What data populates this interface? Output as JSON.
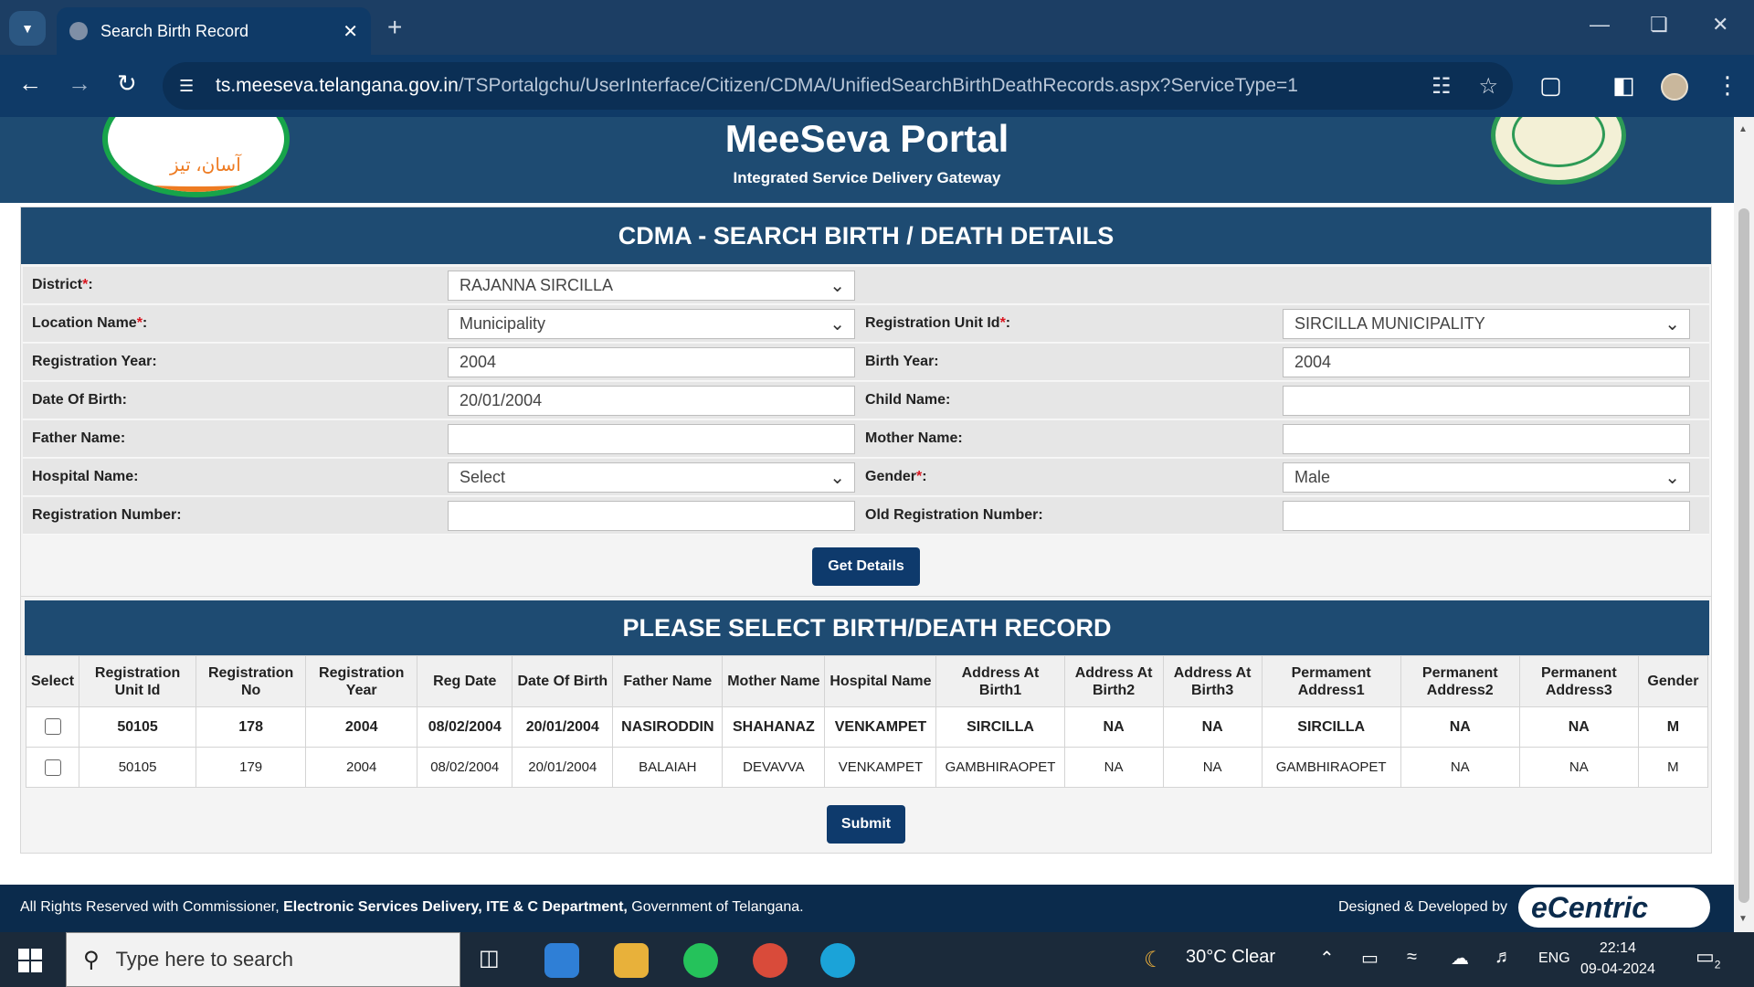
{
  "browser": {
    "tab_title": "Search Birth Record",
    "url_host": "ts.meeseva.telangana.gov.in",
    "url_path": "/TSPortalgchu/UserInterface/Citizen/CDMA/UnifiedSearchBirthDeathRecords.aspx?ServiceType=1",
    "icons": [
      "chevron-down-icon",
      "close-icon",
      "plus-icon",
      "minimize-icon",
      "restore-icon",
      "back-icon",
      "forward-icon",
      "reload-icon",
      "tune-icon",
      "translate-icon",
      "star-icon",
      "extensions-icon",
      "sidepanel-icon",
      "profile-avatar",
      "menu-icon"
    ]
  },
  "header": {
    "left_logo_text": "آسان، تیز",
    "title": "MeeSeva Portal",
    "subtitle": "Integrated Service Delivery Gateway"
  },
  "form": {
    "heading": "CDMA - SEARCH BIRTH / DEATH DETAILS",
    "required_mark": "*",
    "fields": {
      "district": {
        "label": "District",
        "value": "RAJANNA SIRCILLA"
      },
      "location_name": {
        "label": "Location Name",
        "value": "Municipality"
      },
      "registration_unit_id": {
        "label": "Registration Unit Id",
        "value": "SIRCILLA MUNICIPALITY"
      },
      "registration_year": {
        "label": "Registration Year:",
        "value": "2004"
      },
      "birth_year": {
        "label": "Birth Year:",
        "value": "2004"
      },
      "date_of_birth": {
        "label": "Date Of Birth:",
        "value": "20/01/2004"
      },
      "child_name": {
        "label": "Child Name:",
        "value": ""
      },
      "father_name": {
        "label": "Father Name:",
        "value": ""
      },
      "mother_name": {
        "label": "Mother Name:",
        "value": ""
      },
      "hospital_name": {
        "label": "Hospital Name:",
        "value": "Select"
      },
      "gender": {
        "label": "Gender",
        "value": "Male"
      },
      "registration_number": {
        "label": "Registration Number:",
        "value": ""
      },
      "old_registration_number": {
        "label": "Old Registration Number:",
        "value": ""
      }
    },
    "get_details_label": "Get Details"
  },
  "records": {
    "heading": "PLEASE SELECT BIRTH/DEATH RECORD",
    "columns": [
      "Select",
      "Registration Unit Id",
      "Registration No",
      "Registration Year",
      "Reg Date",
      "Date Of Birth",
      "Father Name",
      "Mother Name",
      "Hospital Name",
      "Address At Birth1",
      "Address At Birth2",
      "Address At Birth3",
      "Permament Address1",
      "Permanent Address2",
      "Permanent Address3",
      "Gender"
    ],
    "rows": [
      [
        "",
        "50105",
        "178",
        "2004",
        "08/02/2004",
        "20/01/2004",
        "NASIRODDIN",
        "SHAHANAZ",
        "VENKAMPET",
        "SIRCILLA",
        "NA",
        "NA",
        "SIRCILLA",
        "NA",
        "NA",
        "M"
      ],
      [
        "",
        "50105",
        "179",
        "2004",
        "08/02/2004",
        "20/01/2004",
        "BALAIAH",
        "DEVAVVA",
        "VENKAMPET",
        "GAMBHIRAOPET",
        "NA",
        "NA",
        "GAMBHIRAOPET",
        "NA",
        "NA",
        "M"
      ]
    ],
    "submit_label": "Submit"
  },
  "footer": {
    "text_prefix": "All Rights Reserved with Commissioner, ",
    "text_bold": "Electronic Services Delivery, ITE & C Department,",
    "text_suffix": " Government of Telangana.",
    "designed_by": "Designed & Developed by",
    "brand": "eCentric"
  },
  "taskbar": {
    "search_placeholder": "Type here to search",
    "weather": "30°C  Clear",
    "language": "ENG",
    "time": "22:14",
    "date": "09-04-2024",
    "notifications": "2"
  }
}
